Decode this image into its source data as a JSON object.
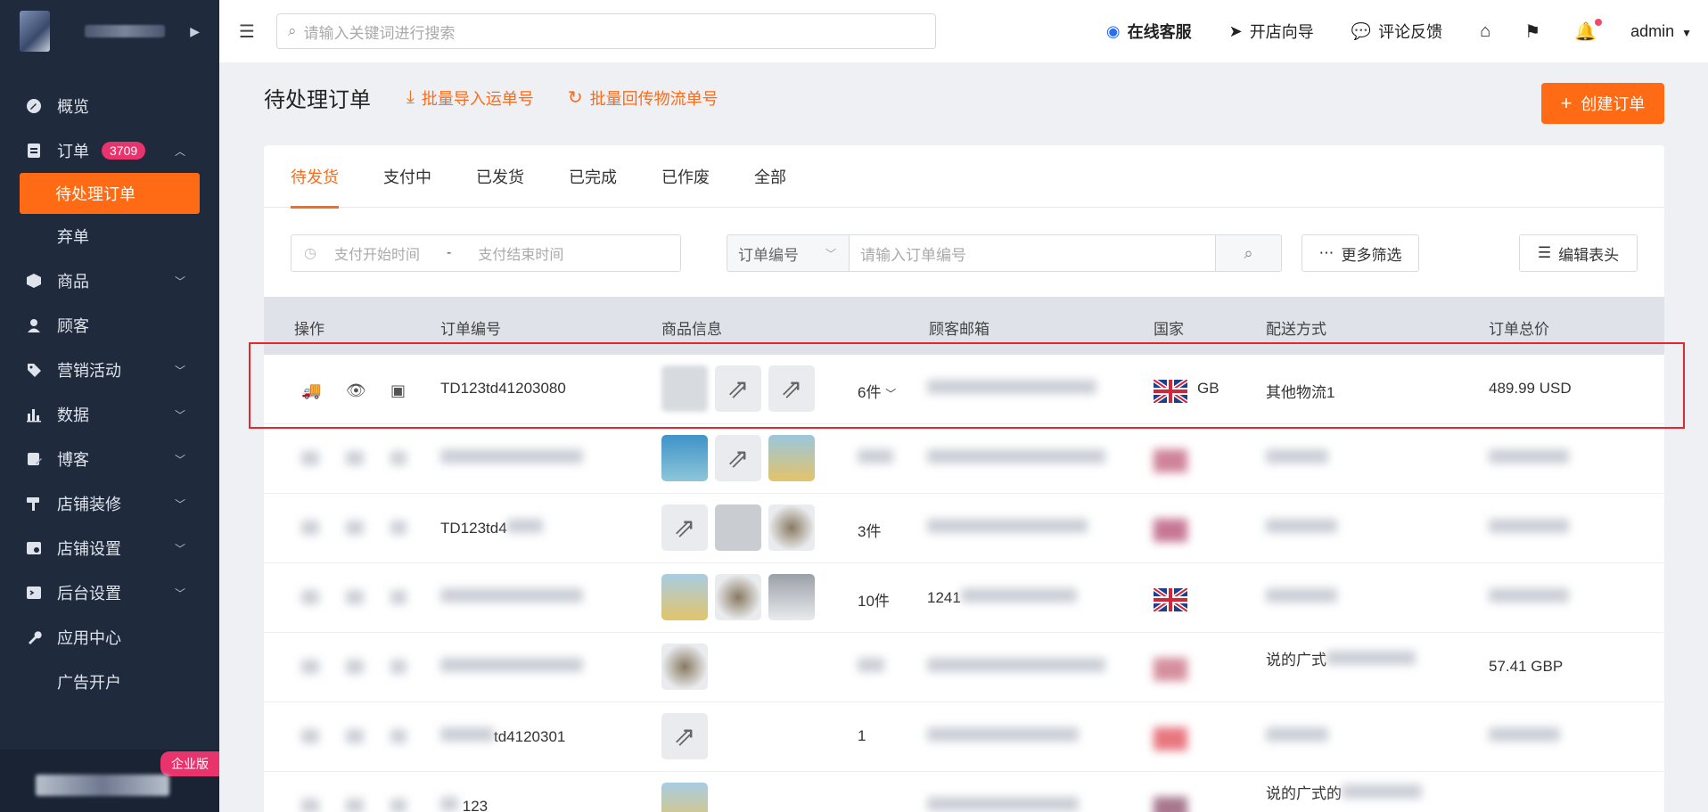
{
  "topbar": {
    "search_placeholder": "请输入关键词进行搜索",
    "online_service": "在线客服",
    "store_guide": "开店向导",
    "feedback": "评论反馈",
    "user": "admin"
  },
  "sidebar": {
    "items": [
      {
        "label": "概览",
        "icon": "dashboard-icon"
      },
      {
        "label": "订单",
        "icon": "order-icon",
        "badge": "3709"
      },
      {
        "label": "待处理订单",
        "active": true
      },
      {
        "label": "弃单"
      },
      {
        "label": "商品",
        "icon": "product-icon"
      },
      {
        "label": "顾客",
        "icon": "customer-icon"
      },
      {
        "label": "营销活动",
        "icon": "marketing-icon"
      },
      {
        "label": "数据",
        "icon": "data-icon"
      },
      {
        "label": "博客",
        "icon": "blog-icon"
      },
      {
        "label": "店铺装修",
        "icon": "decoration-icon"
      },
      {
        "label": "店铺设置",
        "icon": "store-settings-icon"
      },
      {
        "label": "后台设置",
        "icon": "admin-settings-icon"
      },
      {
        "label": "应用中心",
        "icon": "app-center-icon"
      },
      {
        "label": "广告开户"
      }
    ],
    "edition": "企业版"
  },
  "page": {
    "title": "待处理订单",
    "import_tracking": "批量导入运单号",
    "sync_tracking": "批量回传物流单号",
    "create_order": "创建订单"
  },
  "tabs": [
    "待发货",
    "支付中",
    "已发货",
    "已完成",
    "已作废",
    "全部"
  ],
  "filters": {
    "start_date": "支付开始时间",
    "date_separator": "-",
    "end_date": "支付结束时间",
    "field_select": "订单编号",
    "order_placeholder": "请输入订单编号",
    "more_filters": "更多筛选",
    "edit_columns": "编辑表头"
  },
  "table": {
    "headers": [
      "操作",
      "订单编号",
      "商品信息",
      "顾客邮箱",
      "国家",
      "配送方式",
      "订单总价"
    ],
    "rows": [
      {
        "order_id": "TD123td41203080",
        "qty": "6件",
        "email": "",
        "country": "GB",
        "shipping": "其他物流1",
        "total": "489.99 USD",
        "highlighted": true
      },
      {
        "order_id": "",
        "qty": "",
        "email": "",
        "country": "",
        "shipping": "",
        "total": ""
      },
      {
        "order_id": "TD123td4",
        "qty": "3件",
        "email": "",
        "country": "",
        "shipping": "",
        "total": ""
      },
      {
        "order_id": "",
        "qty": "10件",
        "email": "1241",
        "country": "",
        "shipping": "",
        "total": ""
      },
      {
        "order_id": "",
        "qty": "",
        "email": "",
        "country": "",
        "shipping": "说的广式",
        "total": "57.41 GBP"
      },
      {
        "order_id": "td4120301",
        "qty": "1",
        "email": "",
        "country": "",
        "shipping": "",
        "total": ""
      },
      {
        "order_id": "123",
        "qty": "",
        "email": "",
        "country": "",
        "shipping": "说的广式的",
        "total": ""
      }
    ]
  },
  "colors": {
    "accent": "#ff6a14",
    "sidebar": "#1f2a3d",
    "badge": "#e8336d",
    "highlight": "#e8262b"
  }
}
